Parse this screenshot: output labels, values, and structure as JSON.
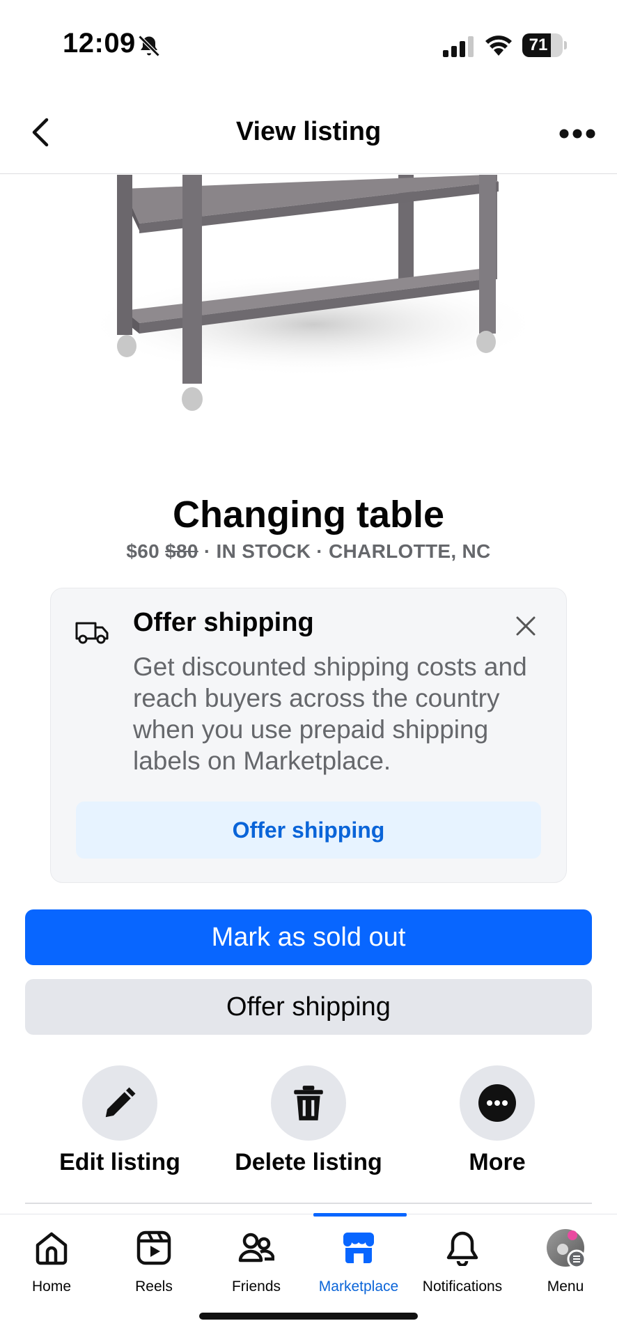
{
  "status_bar": {
    "time": "12:09",
    "battery": "71",
    "battery_level": 0.71
  },
  "header": {
    "title": "View listing"
  },
  "listing": {
    "title": "Changing table",
    "price": "$60",
    "original_price": "$80",
    "meta": " · IN STOCK · CHARLOTTE, NC"
  },
  "offer_card": {
    "title": "Offer shipping",
    "description": "Get discounted shipping costs and reach buyers across the country when you use prepaid shipping labels on Marketplace.",
    "button_label": "Offer shipping"
  },
  "buttons": {
    "primary": "Mark as sold out",
    "secondary": "Offer shipping"
  },
  "actions": [
    {
      "label": "Edit listing",
      "icon": "pencil-icon"
    },
    {
      "label": "Delete listing",
      "icon": "trash-icon"
    },
    {
      "label": "More",
      "icon": "more-circle-icon"
    }
  ],
  "tabs": [
    {
      "label": "Home",
      "icon": "home-icon"
    },
    {
      "label": "Reels",
      "icon": "reels-icon"
    },
    {
      "label": "Friends",
      "icon": "friends-icon"
    },
    {
      "label": "Marketplace",
      "icon": "marketplace-icon",
      "active": true
    },
    {
      "label": "Notifications",
      "icon": "bell-icon"
    },
    {
      "label": "Menu",
      "icon": "avatar"
    }
  ],
  "colors": {
    "accent": "#0866ff",
    "link": "#0a64d8",
    "muted": "#65676b",
    "card": "#f5f6f8"
  }
}
